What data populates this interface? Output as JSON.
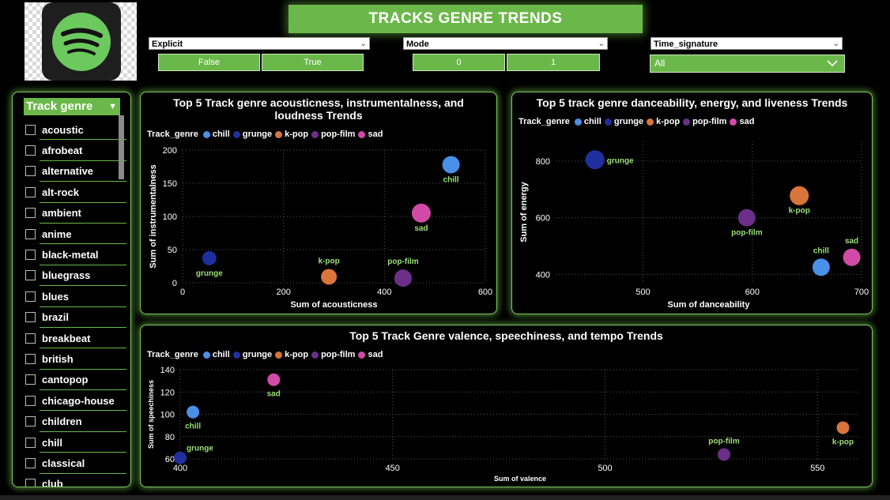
{
  "page_title": "TRACKS GENRE TRENDS",
  "colors": {
    "accent": "#6bb84a",
    "panel_border": "#7ec866",
    "label_green": "#9be07a"
  },
  "filters": {
    "explicit": {
      "label": "Explicit",
      "options": [
        "False",
        "True"
      ]
    },
    "mode": {
      "label": "Mode",
      "options": [
        "0",
        "1"
      ]
    },
    "time_signature": {
      "label": "Time_signature",
      "selected": "All"
    }
  },
  "genre_slicer": {
    "title": "Track genre",
    "items": [
      "acoustic",
      "afrobeat",
      "alternative",
      "alt-rock",
      "ambient",
      "anime",
      "black-metal",
      "bluegrass",
      "blues",
      "brazil",
      "breakbeat",
      "british",
      "cantopop",
      "chicago-house",
      "children",
      "chill",
      "classical",
      "club"
    ]
  },
  "legend": {
    "title": "Track_genre",
    "items": [
      {
        "name": "chill",
        "color": "#4a8fe8"
      },
      {
        "name": "grunge",
        "color": "#1f2f9e"
      },
      {
        "name": "k-pop",
        "color": "#d9743a"
      },
      {
        "name": "pop-film",
        "color": "#6b2f8a"
      },
      {
        "name": "sad",
        "color": "#d24aa8"
      }
    ]
  },
  "chart_data": [
    {
      "type": "scatter",
      "title": "Top 5 Track genre acousticness, instrumentalness, and loudness Trends",
      "xlabel": "Sum of acousticness",
      "ylabel": "Sum of instrumentalness",
      "xlim": [
        0,
        600
      ],
      "ylim": [
        0,
        200
      ],
      "xticks": [
        0,
        200,
        400,
        600
      ],
      "yticks": [
        0,
        50,
        100,
        150,
        200
      ],
      "grid": true,
      "points": [
        {
          "name": "chill",
          "x": 532,
          "y": 178,
          "size": 11
        },
        {
          "name": "grunge",
          "x": 53,
          "y": 37,
          "size": 9
        },
        {
          "name": "k-pop",
          "x": 290,
          "y": 9,
          "size": 10
        },
        {
          "name": "pop-film",
          "x": 437,
          "y": 7,
          "size": 11
        },
        {
          "name": "sad",
          "x": 473,
          "y": 105,
          "size": 12
        }
      ]
    },
    {
      "type": "scatter",
      "title": "Top 5 track genre danceability, energy, and liveness Trends",
      "xlabel": "Sum of danceability",
      "ylabel": "Sum of energy",
      "xlim": [
        420,
        700
      ],
      "ylim": [
        370,
        870
      ],
      "xticks": [
        500,
        600,
        700
      ],
      "yticks": [
        400,
        600,
        800
      ],
      "grid": true,
      "points": [
        {
          "name": "chill",
          "x": 663,
          "y": 425,
          "size": 11
        },
        {
          "name": "grunge",
          "x": 456,
          "y": 805,
          "size": 12
        },
        {
          "name": "k-pop",
          "x": 643,
          "y": 678,
          "size": 12
        },
        {
          "name": "pop-film",
          "x": 595,
          "y": 600,
          "size": 11
        },
        {
          "name": "sad",
          "x": 691,
          "y": 460,
          "size": 11
        }
      ]
    },
    {
      "type": "scatter",
      "title": "Top 5 Track Genre valence, speechiness, and tempo Trends",
      "xlabel": "Sum of valence",
      "ylabel": "Sum of speechiness",
      "xlim": [
        400,
        560
      ],
      "ylim": [
        60,
        140
      ],
      "xticks": [
        400,
        450,
        500,
        550
      ],
      "yticks": [
        60,
        80,
        100,
        120,
        140
      ],
      "grid": true,
      "points": [
        {
          "name": "chill",
          "x": 403,
          "y": 102,
          "size": 8
        },
        {
          "name": "grunge",
          "x": 400,
          "y": 61,
          "size": 8
        },
        {
          "name": "k-pop",
          "x": 556,
          "y": 88,
          "size": 8
        },
        {
          "name": "pop-film",
          "x": 528,
          "y": 64,
          "size": 8
        },
        {
          "name": "sad",
          "x": 422,
          "y": 131,
          "size": 8
        }
      ]
    }
  ]
}
